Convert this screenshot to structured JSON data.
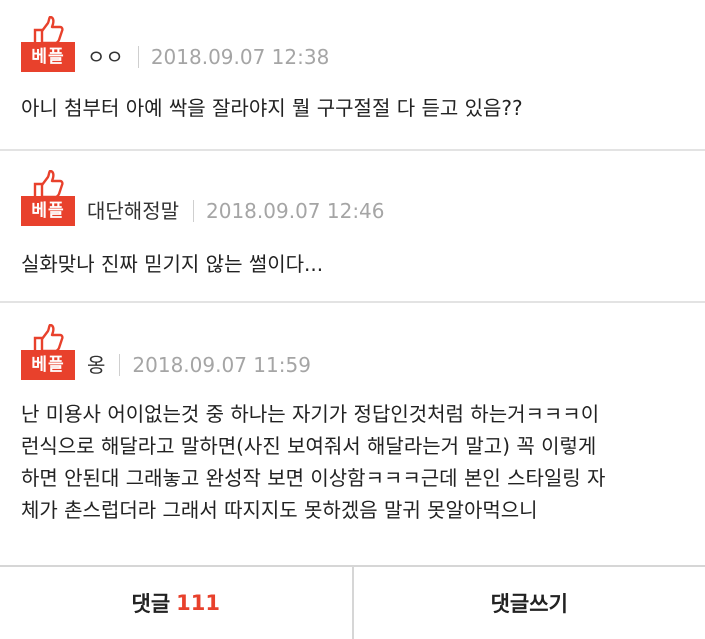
{
  "comments": [
    {
      "badge": "베플",
      "nickname": "ㅇㅇ",
      "date": "2018.09.07 12:38",
      "text": "아니 첨부터 아예 싹을 잘라야지 뭘 구구절절 다 듣고 있음??"
    },
    {
      "badge": "베플",
      "nickname": "대단해정말",
      "date": "2018.09.07 12:46",
      "text": "실화맞나 진짜 믿기지 않는 썰이다..."
    },
    {
      "badge": "베플",
      "nickname": "옹",
      "date": "2018.09.07 11:59",
      "text": "난 미용사 어이없는것 중 하나는 자기가 정답인것처럼 하는거ㅋㅋㅋ이\n런식으로 해달라고 말하면(사진 보여줘서 해달라는거 말고) 꼭 이렇게\n하면 안된대 그래놓고 완성작 보면 이상함ㅋㅋㅋ근데 본인 스타일링 자\n체가 촌스럽더라 그래서 따지지도 못하겠음 말귀 못알아먹으니"
    }
  ],
  "bottom_bar": {
    "comments_label": "댓글",
    "comments_count": "111",
    "write_label": "댓글쓰기"
  },
  "colors": {
    "accent": "#e8412c",
    "date_gray": "#a5a5a5",
    "divider": "#e3e3e3"
  },
  "icons": {
    "best_badge": "thumbs-up-icon"
  }
}
